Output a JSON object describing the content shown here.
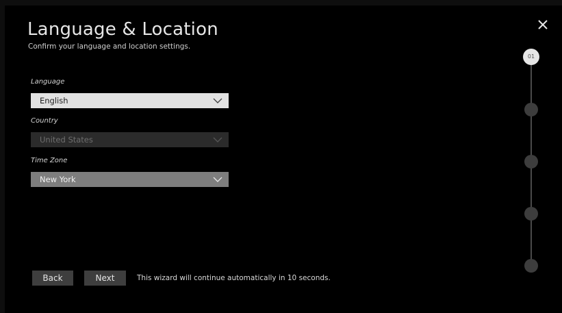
{
  "wizard": {
    "title": "Language & Location",
    "subtitle": "Confirm your language and location settings.",
    "close_icon": "close-icon"
  },
  "fields": {
    "language": {
      "label": "Language",
      "value": "English"
    },
    "country": {
      "label": "Country",
      "value": "United States"
    },
    "time_zone": {
      "label": "Time Zone",
      "value": "New York"
    }
  },
  "footer": {
    "back_label": "Back",
    "next_label": "Next",
    "notice": "This wizard will continue automatically in 10 seconds."
  },
  "progress": {
    "current_step_label": "01",
    "total_steps": 5,
    "current_step": 1
  },
  "colors": {
    "background": "#000000",
    "selected_field": "#e2e2e2",
    "disabled_field": "#2b2b2b",
    "inactive_field": "#7e7e7e",
    "button": "#3e3e3e",
    "step_active": "#e6e6e6",
    "step_inactive": "#3d3d3d"
  }
}
